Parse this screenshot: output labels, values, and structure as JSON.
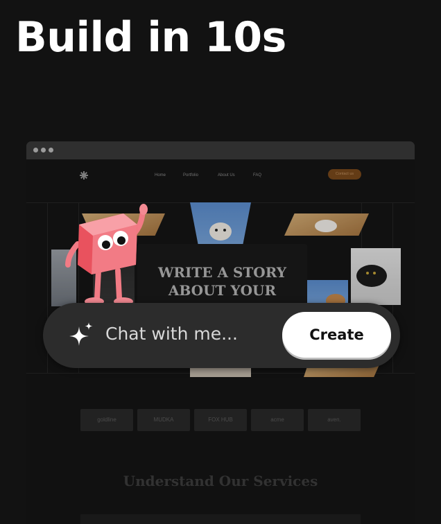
{
  "headline": "Build in 10s",
  "site": {
    "nav": [
      "Home",
      "Portfolio",
      "About Us",
      "FAQ"
    ],
    "contact_label": "Contact us",
    "hero_title": "WRITE A STORY\nABOUT YOUR",
    "brand_logos": [
      "goldline",
      "MUDKA",
      "FOX HUB",
      "acme",
      "aven."
    ],
    "services_title": "Understand Our Services"
  },
  "chat": {
    "placeholder": "Chat with me...",
    "create_label": "Create"
  },
  "colors": {
    "background": "#121212",
    "pill": "#2c2c2c",
    "mascot": "#f2606a",
    "accent_button": "#7a4a1c"
  },
  "icons": [
    "browser-dots-icon",
    "site-logo-icon",
    "sparkle-icon",
    "mascot-icon"
  ]
}
